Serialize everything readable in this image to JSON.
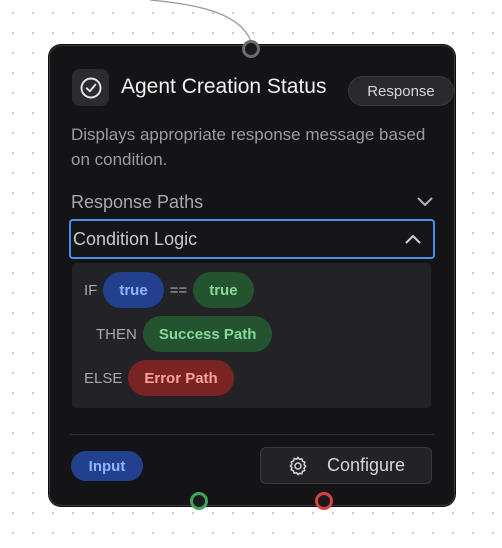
{
  "node": {
    "title": "Agent Creation Status",
    "output_badge": "Response",
    "description": "Displays appropriate response message based on condition.",
    "sections": {
      "response_paths": "Response Paths",
      "condition_logic": "Condition Logic"
    },
    "logic": {
      "if_keyword": "IF",
      "left_operand": "true",
      "operator": "==",
      "right_operand": "true",
      "then_keyword": "THEN",
      "then_target": "Success Path",
      "else_keyword": "ELSE",
      "else_target": "Error Path"
    },
    "input_badge": "Input",
    "configure_label": "Configure"
  },
  "icons": {
    "header": "check-circle-icon",
    "response_paths_toggle": "chevron-down-icon",
    "condition_logic_toggle": "chevron-up-icon",
    "configure": "gear-icon"
  },
  "colors": {
    "input_handle": "#6b6b70",
    "success_handle": "#3ea55a",
    "error_handle": "#d94040",
    "focus_border": "#4a8ef0"
  }
}
